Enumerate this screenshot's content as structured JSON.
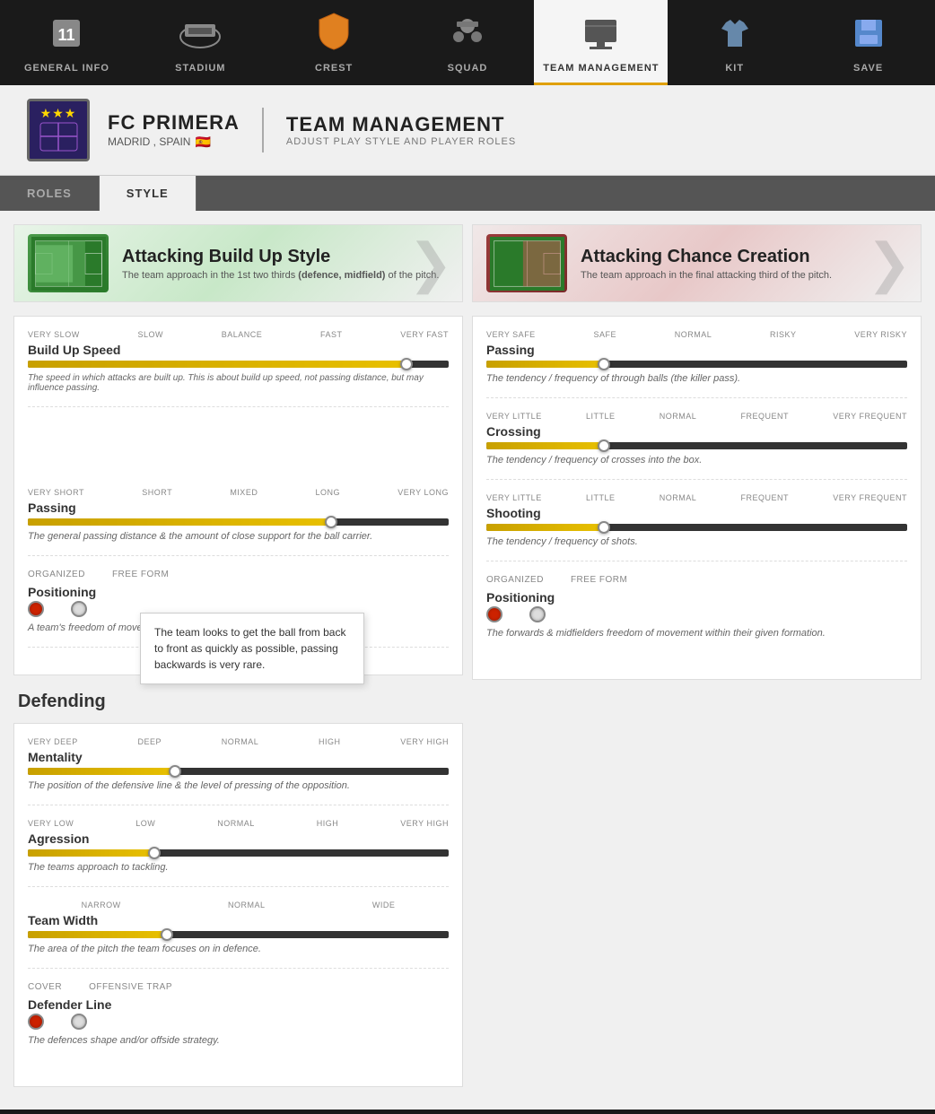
{
  "nav": {
    "items": [
      {
        "id": "general-info",
        "label": "GENERAL INFO",
        "icon": "🏆",
        "active": false
      },
      {
        "id": "stadium",
        "label": "STADIUM",
        "icon": "🏟️",
        "active": false
      },
      {
        "id": "crest",
        "label": "CREST",
        "icon": "🔶",
        "active": false
      },
      {
        "id": "squad",
        "label": "SQUAD",
        "icon": "👤",
        "active": false
      },
      {
        "id": "team-management",
        "label": "TEAM MANAGEMENT",
        "icon": "📋",
        "active": true
      },
      {
        "id": "kit",
        "label": "KIT",
        "icon": "👕",
        "active": false
      },
      {
        "id": "save",
        "label": "SAVE",
        "icon": "💾",
        "active": false
      }
    ]
  },
  "header": {
    "team_name": "FC PRIMERA",
    "location": "MADRID , SPAIN",
    "flag": "🇪🇸",
    "section_title": "TEAM MANAGEMENT",
    "section_subtitle": "ADJUST PLAY STYLE AND PLAYER ROLES"
  },
  "tabs": [
    {
      "id": "roles",
      "label": "ROLES",
      "active": false
    },
    {
      "id": "style",
      "label": "STYLE",
      "active": true
    }
  ],
  "left_panel": {
    "style_card": {
      "title": "Attacking Build Up Style",
      "description": "The team approach in the 1st two thirds",
      "description_bold": "(defence, midfield)",
      "description_end": "of the pitch."
    },
    "tooltip": {
      "text": "The team looks to get the ball from back to front as quickly as possible, passing backwards is very rare."
    },
    "build_up_speed": {
      "title": "Build Up Speed",
      "labels": [
        "VERY SLOW",
        "SLOW",
        "BALANCE",
        "FAST",
        "VERY FAST"
      ],
      "value": 90,
      "description": "The speed in which attacks are built up. This is about build up speed, not passing distance, but may influence passing."
    },
    "passing": {
      "title": "Passing",
      "labels": [
        "VERY SHORT",
        "SHORT",
        "MIXED",
        "LONG",
        "VERY LONG"
      ],
      "value": 72,
      "description": "The general passing distance & the amount of close support for the ball carrier."
    },
    "positioning": {
      "title": "Positioning",
      "option1": "ORGANIZED",
      "option2": "FREE FORM",
      "selected": "organized",
      "description": "A team's freedom of movement within their given formation."
    },
    "defending_title": "Defending",
    "mentality": {
      "title": "Mentality",
      "labels": [
        "VERY DEEP",
        "DEEP",
        "NORMAL",
        "HIGH",
        "VERY HIGH"
      ],
      "value": 35,
      "description": "The position of the defensive line & the level of pressing of the opposition."
    },
    "aggression": {
      "title": "Agression",
      "labels": [
        "VERY LOW",
        "LOW",
        "NORMAL",
        "HIGH",
        "VERY HIGH"
      ],
      "value": 30,
      "description": "The teams approach to tackling."
    },
    "team_width": {
      "title": "Team Width",
      "labels": [
        "NARROW",
        "NORMAL",
        "WIDE"
      ],
      "value": 33,
      "description": "The area of the pitch the team focuses on in defence."
    },
    "defender_line": {
      "title": "Defender Line",
      "option1": "COVER",
      "option2": "OFFENSIVE TRAP",
      "selected": "cover",
      "description": "The defences shape and/or offside strategy."
    }
  },
  "right_panel": {
    "style_card": {
      "title": "Attacking Chance Creation",
      "description": "The team approach in the final attacking third of the pitch."
    },
    "passing": {
      "title": "Passing",
      "labels": [
        "VERY SAFE",
        "SAFE",
        "NORMAL",
        "RISKY",
        "VERY RISKY"
      ],
      "value": 28,
      "description": "The tendency / frequency of through balls (the killer pass)."
    },
    "crossing": {
      "title": "Crossing",
      "labels": [
        "VERY LITTLE",
        "LITTLE",
        "NORMAL",
        "FREQUENT",
        "VERY FREQUENT"
      ],
      "value": 28,
      "description": "The tendency / frequency of crosses into the box."
    },
    "shooting": {
      "title": "Shooting",
      "labels": [
        "VERY LITTLE",
        "LITTLE",
        "NORMAL",
        "FREQUENT",
        "VERY FREQUENT"
      ],
      "value": 28,
      "description": "The tendency / frequency of shots."
    },
    "positioning": {
      "title": "Positioning",
      "option1": "ORGANIZED",
      "option2": "FREE FORM",
      "selected": "organized",
      "description": "The forwards & midfielders freedom of movement within their given formation."
    }
  }
}
